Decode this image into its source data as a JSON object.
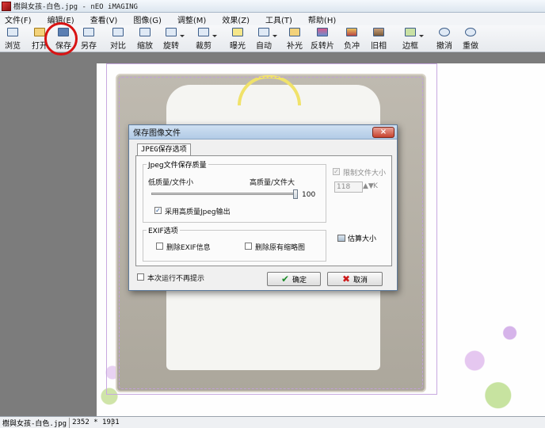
{
  "window": {
    "title": "樹與女孩-白色.jpg - nEO iMAGING"
  },
  "menubar": {
    "items": [
      "文件(F)",
      "编辑(E)",
      "查看(V)",
      "图像(G)",
      "调整(M)",
      "效果(Z)",
      "工具(T)",
      "帮助(H)"
    ]
  },
  "toolbar": {
    "items": [
      "浏览",
      "打开",
      "保存",
      "另存",
      "对比",
      "缩放",
      "旋转",
      "裁剪",
      "曝光",
      "自动",
      "补光",
      "反转片",
      "负冲",
      "旧相",
      "边框",
      "撤消",
      "重做"
    ],
    "highlighted": "保存",
    "highlight_color": "#d81414"
  },
  "status": {
    "filename": "樹與女孩-白色.jpg",
    "dimensions": "2352 * 1931"
  },
  "dialog": {
    "title": "保存图像文件",
    "close": "×",
    "tab": "JPEG保存选项",
    "quality_group": "Jpeg文件保存质量",
    "low_label": "低质量/文件小",
    "high_label": "高质量/文件大",
    "quality_value": "100",
    "quality_level": 1.0,
    "high_quality_checkbox": "采用高质量Jpeg输出",
    "high_quality_checked": true,
    "limit_checkbox": "限制文件大小",
    "limit_checked": true,
    "limit_value": "118",
    "limit_unit": "K",
    "estimate_button": "估算大小",
    "exif_group": "EXIF选项",
    "remove_exif": "删除EXIF信息",
    "remove_thumb": "删除原有缩略图",
    "no_prompt": "本次运行不再提示",
    "ok_label": "确定",
    "cancel_label": "取消"
  }
}
